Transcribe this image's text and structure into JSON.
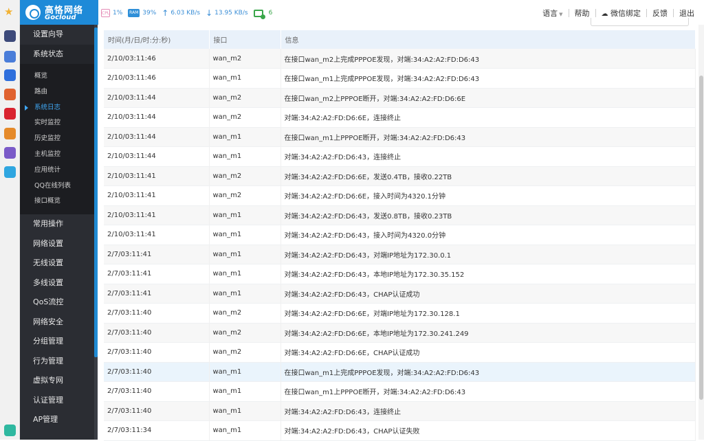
{
  "brand": {
    "name_cn": "高恪网络",
    "name_en": "Gocloud",
    "color": "#1e8ad8"
  },
  "stats": {
    "cpu_chip": "CPU",
    "cpu": "1%",
    "ram_chip": "RAM",
    "ram": "39%",
    "upload": "6.03 KB/s",
    "download": "13.95 KB/s",
    "online": "6"
  },
  "topnav": {
    "language": "语言",
    "help": "帮助",
    "wechat_bind": "微信绑定",
    "feedback": "反馈",
    "logout": "退出"
  },
  "dock_apps": [
    {
      "icon": "star-icon",
      "color": "#f2b233"
    },
    {
      "icon": "app-icon",
      "color": "#3d4a7a"
    },
    {
      "icon": "app-icon",
      "color": "#4a7dd9"
    },
    {
      "icon": "app-icon",
      "color": "#2f6fdc"
    },
    {
      "icon": "app-icon",
      "color": "#e0622f"
    },
    {
      "icon": "app-icon",
      "color": "#d9232f"
    },
    {
      "icon": "app-icon",
      "color": "#e58a2a"
    },
    {
      "icon": "app-icon",
      "color": "#7a5ac8"
    },
    {
      "icon": "app-icon",
      "color": "#2fa6e0"
    },
    {
      "icon": "app-icon",
      "color": "#2fb8a0"
    }
  ],
  "sidebar": {
    "top_items": [
      "设置向导",
      "系统状态"
    ],
    "sub_items": [
      "概览",
      "路由",
      "系统日志",
      "实时监控",
      "历史监控",
      "主机监控",
      "应用统计",
      "QQ在线列表",
      "接口概览"
    ],
    "active_sub": "系统日志",
    "bottom_items": [
      "常用操作",
      "网络设置",
      "无线设置",
      "多线设置",
      "QoS流控",
      "网络安全",
      "分组管理",
      "行为管理",
      "虚拟专网",
      "认证管理",
      "AP管理"
    ]
  },
  "log_table": {
    "columns": [
      "时间(月/日/时:分:秒)",
      "接口",
      "信息"
    ],
    "highlight_row": 16,
    "rows": [
      [
        "2/10/03:11:46",
        "wan_m2",
        "在接口wan_m2上完成PPPOE发现，对端:34:A2:A2:FD:D6:43"
      ],
      [
        "2/10/03:11:46",
        "wan_m1",
        "在接口wan_m1上完成PPPOE发现，对端:34:A2:A2:FD:D6:43"
      ],
      [
        "2/10/03:11:44",
        "wan_m2",
        "在接口wan_m2上PPPOE断开，对端:34:A2:A2:FD:D6:6E"
      ],
      [
        "2/10/03:11:44",
        "wan_m2",
        "对端:34:A2:A2:FD:D6:6E，连接终止"
      ],
      [
        "2/10/03:11:44",
        "wan_m1",
        "在接口wan_m1上PPPOE断开，对端:34:A2:A2:FD:D6:43"
      ],
      [
        "2/10/03:11:44",
        "wan_m1",
        "对端:34:A2:A2:FD:D6:43，连接终止"
      ],
      [
        "2/10/03:11:41",
        "wan_m2",
        "对端:34:A2:A2:FD:D6:6E，发送0.4TB，接收0.22TB"
      ],
      [
        "2/10/03:11:41",
        "wan_m2",
        "对端:34:A2:A2:FD:D6:6E，接入时间为4320.1分钟"
      ],
      [
        "2/10/03:11:41",
        "wan_m1",
        "对端:34:A2:A2:FD:D6:43，发送0.8TB，接收0.23TB"
      ],
      [
        "2/10/03:11:41",
        "wan_m1",
        "对端:34:A2:A2:FD:D6:43，接入时间为4320.0分钟"
      ],
      [
        "2/7/03:11:41",
        "wan_m1",
        "对端:34:A2:A2:FD:D6:43，对端IP地址为172.30.0.1"
      ],
      [
        "2/7/03:11:41",
        "wan_m1",
        "对端:34:A2:A2:FD:D6:43，本地IP地址为172.30.35.152"
      ],
      [
        "2/7/03:11:41",
        "wan_m1",
        "对端:34:A2:A2:FD:D6:43，CHAP认证成功"
      ],
      [
        "2/7/03:11:40",
        "wan_m2",
        "对端:34:A2:A2:FD:D6:6E，对端IP地址为172.30.128.1"
      ],
      [
        "2/7/03:11:40",
        "wan_m2",
        "对端:34:A2:A2:FD:D6:6E，本地IP地址为172.30.241.249"
      ],
      [
        "2/7/03:11:40",
        "wan_m2",
        "对端:34:A2:A2:FD:D6:6E，CHAP认证成功"
      ],
      [
        "2/7/03:11:40",
        "wan_m1",
        "在接口wan_m1上完成PPPOE发现，对端:34:A2:A2:FD:D6:43"
      ],
      [
        "2/7/03:11:40",
        "wan_m1",
        "在接口wan_m1上PPPOE断开，对端:34:A2:A2:FD:D6:43"
      ],
      [
        "2/7/03:11:40",
        "wan_m1",
        "对端:34:A2:A2:FD:D6:43，连接终止"
      ],
      [
        "2/7/03:11:34",
        "wan_m1",
        "对端:34:A2:A2:FD:D6:43，CHAP认证失败"
      ]
    ]
  }
}
